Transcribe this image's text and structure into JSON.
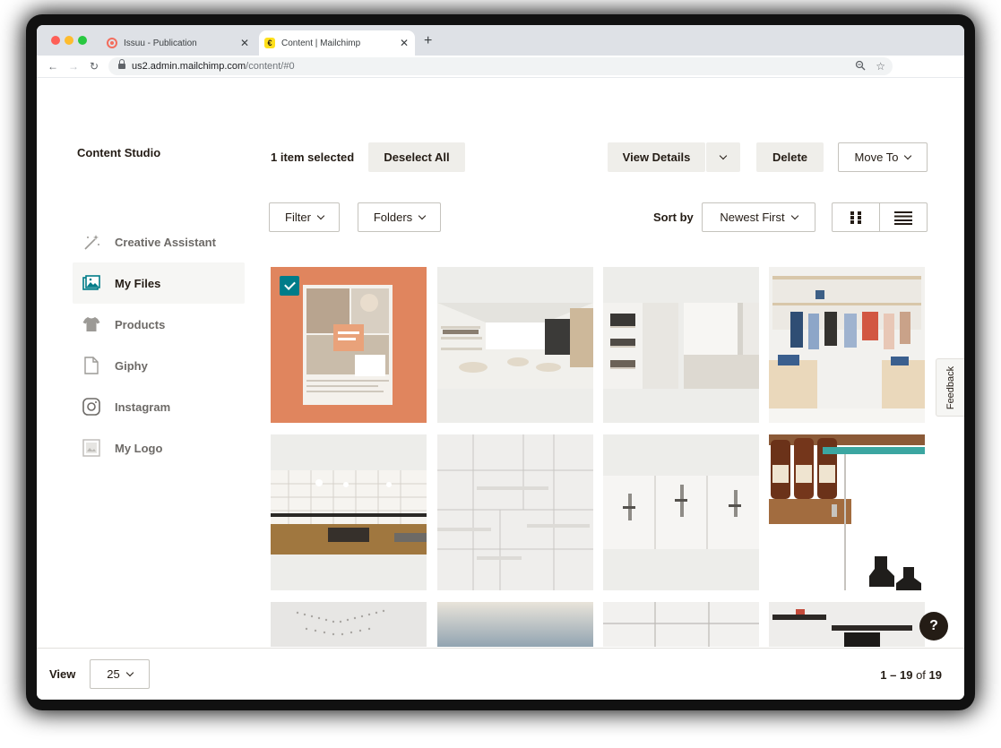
{
  "browser": {
    "tabs": [
      {
        "title": "Issuu - Publication",
        "favicon": "issuu-icon",
        "active": false
      },
      {
        "title": "Content | Mailchimp",
        "favicon": "mailchimp-icon",
        "active": true
      }
    ],
    "url_host": "us2.admin.mailchimp.com",
    "url_path": "/content/#0"
  },
  "app": {
    "title": "Content Studio"
  },
  "sidebar": {
    "items": [
      {
        "label": "Creative Assistant",
        "icon": "magic-wand-icon"
      },
      {
        "label": "My Files",
        "icon": "images-icon",
        "active": true
      },
      {
        "label": "Products",
        "icon": "tshirt-icon"
      },
      {
        "label": "Giphy",
        "icon": "file-icon"
      },
      {
        "label": "Instagram",
        "icon": "instagram-icon"
      },
      {
        "label": "My Logo",
        "icon": "logo-image-icon"
      }
    ]
  },
  "selection": {
    "count_text": "1 item selected",
    "deselect_label": "Deselect All",
    "view_details_label": "View Details",
    "delete_label": "Delete",
    "move_to_label": "Move To"
  },
  "filters": {
    "filter_label": "Filter",
    "folders_label": "Folders",
    "sort_label": "Sort by",
    "sort_value": "Newest First"
  },
  "feedback_label": "Feedback",
  "help_label": "?",
  "footer": {
    "view_label": "View",
    "per_page": "25",
    "range": "1 – 19",
    "of_text": "of",
    "total": "19"
  },
  "colors": {
    "accent": "#007c89",
    "button_bg": "#efeeea",
    "text": "#241c15",
    "tile_bg": "#ededea",
    "first_tile_bg": "#e0855e"
  }
}
